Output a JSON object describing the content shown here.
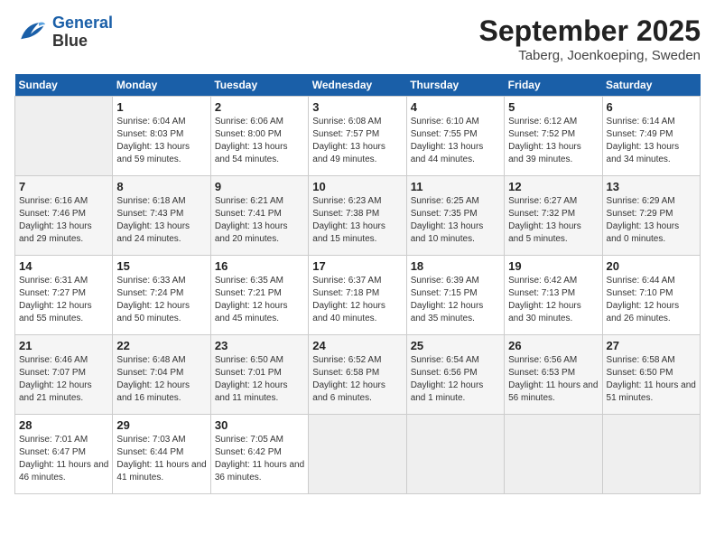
{
  "header": {
    "logo_line1": "General",
    "logo_line2": "Blue",
    "month": "September 2025",
    "location": "Taberg, Joenkoeping, Sweden"
  },
  "weekdays": [
    "Sunday",
    "Monday",
    "Tuesday",
    "Wednesday",
    "Thursday",
    "Friday",
    "Saturday"
  ],
  "weeks": [
    [
      {
        "day": "",
        "empty": true
      },
      {
        "day": "1",
        "sunrise": "6:04 AM",
        "sunset": "8:03 PM",
        "daylight": "13 hours and 59 minutes."
      },
      {
        "day": "2",
        "sunrise": "6:06 AM",
        "sunset": "8:00 PM",
        "daylight": "13 hours and 54 minutes."
      },
      {
        "day": "3",
        "sunrise": "6:08 AM",
        "sunset": "7:57 PM",
        "daylight": "13 hours and 49 minutes."
      },
      {
        "day": "4",
        "sunrise": "6:10 AM",
        "sunset": "7:55 PM",
        "daylight": "13 hours and 44 minutes."
      },
      {
        "day": "5",
        "sunrise": "6:12 AM",
        "sunset": "7:52 PM",
        "daylight": "13 hours and 39 minutes."
      },
      {
        "day": "6",
        "sunrise": "6:14 AM",
        "sunset": "7:49 PM",
        "daylight": "13 hours and 34 minutes."
      }
    ],
    [
      {
        "day": "7",
        "sunrise": "6:16 AM",
        "sunset": "7:46 PM",
        "daylight": "13 hours and 29 minutes."
      },
      {
        "day": "8",
        "sunrise": "6:18 AM",
        "sunset": "7:43 PM",
        "daylight": "13 hours and 24 minutes."
      },
      {
        "day": "9",
        "sunrise": "6:21 AM",
        "sunset": "7:41 PM",
        "daylight": "13 hours and 20 minutes."
      },
      {
        "day": "10",
        "sunrise": "6:23 AM",
        "sunset": "7:38 PM",
        "daylight": "13 hours and 15 minutes."
      },
      {
        "day": "11",
        "sunrise": "6:25 AM",
        "sunset": "7:35 PM",
        "daylight": "13 hours and 10 minutes."
      },
      {
        "day": "12",
        "sunrise": "6:27 AM",
        "sunset": "7:32 PM",
        "daylight": "13 hours and 5 minutes."
      },
      {
        "day": "13",
        "sunrise": "6:29 AM",
        "sunset": "7:29 PM",
        "daylight": "13 hours and 0 minutes."
      }
    ],
    [
      {
        "day": "14",
        "sunrise": "6:31 AM",
        "sunset": "7:27 PM",
        "daylight": "12 hours and 55 minutes."
      },
      {
        "day": "15",
        "sunrise": "6:33 AM",
        "sunset": "7:24 PM",
        "daylight": "12 hours and 50 minutes."
      },
      {
        "day": "16",
        "sunrise": "6:35 AM",
        "sunset": "7:21 PM",
        "daylight": "12 hours and 45 minutes."
      },
      {
        "day": "17",
        "sunrise": "6:37 AM",
        "sunset": "7:18 PM",
        "daylight": "12 hours and 40 minutes."
      },
      {
        "day": "18",
        "sunrise": "6:39 AM",
        "sunset": "7:15 PM",
        "daylight": "12 hours and 35 minutes."
      },
      {
        "day": "19",
        "sunrise": "6:42 AM",
        "sunset": "7:13 PM",
        "daylight": "12 hours and 30 minutes."
      },
      {
        "day": "20",
        "sunrise": "6:44 AM",
        "sunset": "7:10 PM",
        "daylight": "12 hours and 26 minutes."
      }
    ],
    [
      {
        "day": "21",
        "sunrise": "6:46 AM",
        "sunset": "7:07 PM",
        "daylight": "12 hours and 21 minutes."
      },
      {
        "day": "22",
        "sunrise": "6:48 AM",
        "sunset": "7:04 PM",
        "daylight": "12 hours and 16 minutes."
      },
      {
        "day": "23",
        "sunrise": "6:50 AM",
        "sunset": "7:01 PM",
        "daylight": "12 hours and 11 minutes."
      },
      {
        "day": "24",
        "sunrise": "6:52 AM",
        "sunset": "6:58 PM",
        "daylight": "12 hours and 6 minutes."
      },
      {
        "day": "25",
        "sunrise": "6:54 AM",
        "sunset": "6:56 PM",
        "daylight": "12 hours and 1 minute."
      },
      {
        "day": "26",
        "sunrise": "6:56 AM",
        "sunset": "6:53 PM",
        "daylight": "11 hours and 56 minutes."
      },
      {
        "day": "27",
        "sunrise": "6:58 AM",
        "sunset": "6:50 PM",
        "daylight": "11 hours and 51 minutes."
      }
    ],
    [
      {
        "day": "28",
        "sunrise": "7:01 AM",
        "sunset": "6:47 PM",
        "daylight": "11 hours and 46 minutes."
      },
      {
        "day": "29",
        "sunrise": "7:03 AM",
        "sunset": "6:44 PM",
        "daylight": "11 hours and 41 minutes."
      },
      {
        "day": "30",
        "sunrise": "7:05 AM",
        "sunset": "6:42 PM",
        "daylight": "11 hours and 36 minutes."
      },
      {
        "day": "",
        "empty": true
      },
      {
        "day": "",
        "empty": true
      },
      {
        "day": "",
        "empty": true
      },
      {
        "day": "",
        "empty": true
      }
    ]
  ]
}
